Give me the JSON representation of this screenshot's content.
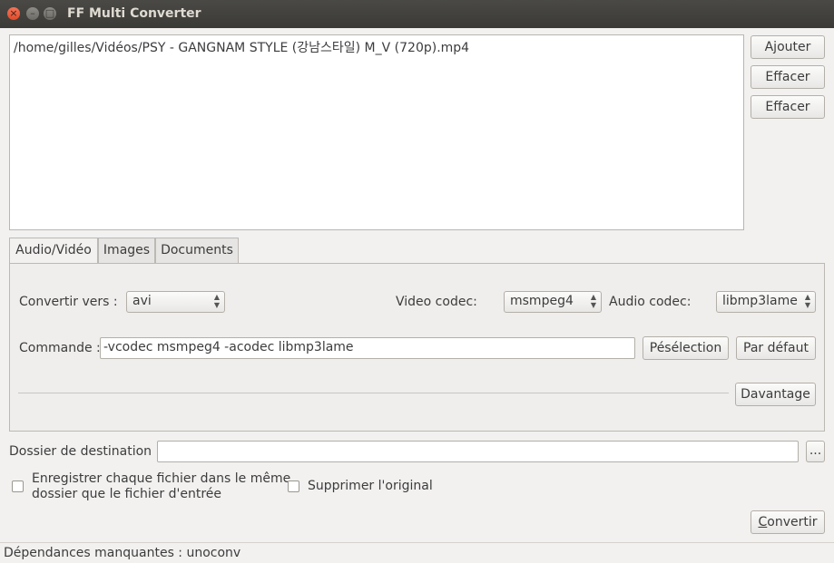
{
  "window": {
    "title": "FF Multi Converter",
    "close_glyph": "×",
    "minimize_glyph": "–",
    "maximize_glyph": "□"
  },
  "file_list": {
    "items": [
      "/home/gilles/Vidéos/PSY - GANGNAM STYLE (강남스타일) M_V (720p).mp4"
    ]
  },
  "side_buttons": {
    "add": "Ajouter",
    "clear1": "Effacer",
    "clear2": "Effacer"
  },
  "tabs": [
    {
      "label": "Audio/Vidéo",
      "active": true
    },
    {
      "label": "Images",
      "active": false
    },
    {
      "label": "Documents",
      "active": false
    }
  ],
  "audio_video": {
    "convert_to_label": "Convertir vers :",
    "convert_to_value": "avi",
    "video_codec_label": "Video codec:",
    "video_codec_value": "msmpeg4",
    "audio_codec_label": "Audio codec:",
    "audio_codec_value": "libmp3lame",
    "command_label": "Commande :",
    "command_value": "-vcodec msmpeg4 -acodec libmp3lame",
    "preselection_button": "Pésélection",
    "default_button": "Par défaut",
    "more_button": "Davantage"
  },
  "destination": {
    "label": "Dossier de destination :",
    "value": "",
    "browse_button": "..."
  },
  "options": {
    "save_same_folder_line1": "Enregistrer chaque fichier dans le même",
    "save_same_folder_line2": "dossier que le fichier d'entrée",
    "save_same_folder_checked": false,
    "delete_original": "Supprimer l'original",
    "delete_original_checked": false
  },
  "convert_button": {
    "first_letter": "C",
    "rest": "onvertir"
  },
  "status": {
    "text": "Dépendances manquantes : unoconv"
  }
}
